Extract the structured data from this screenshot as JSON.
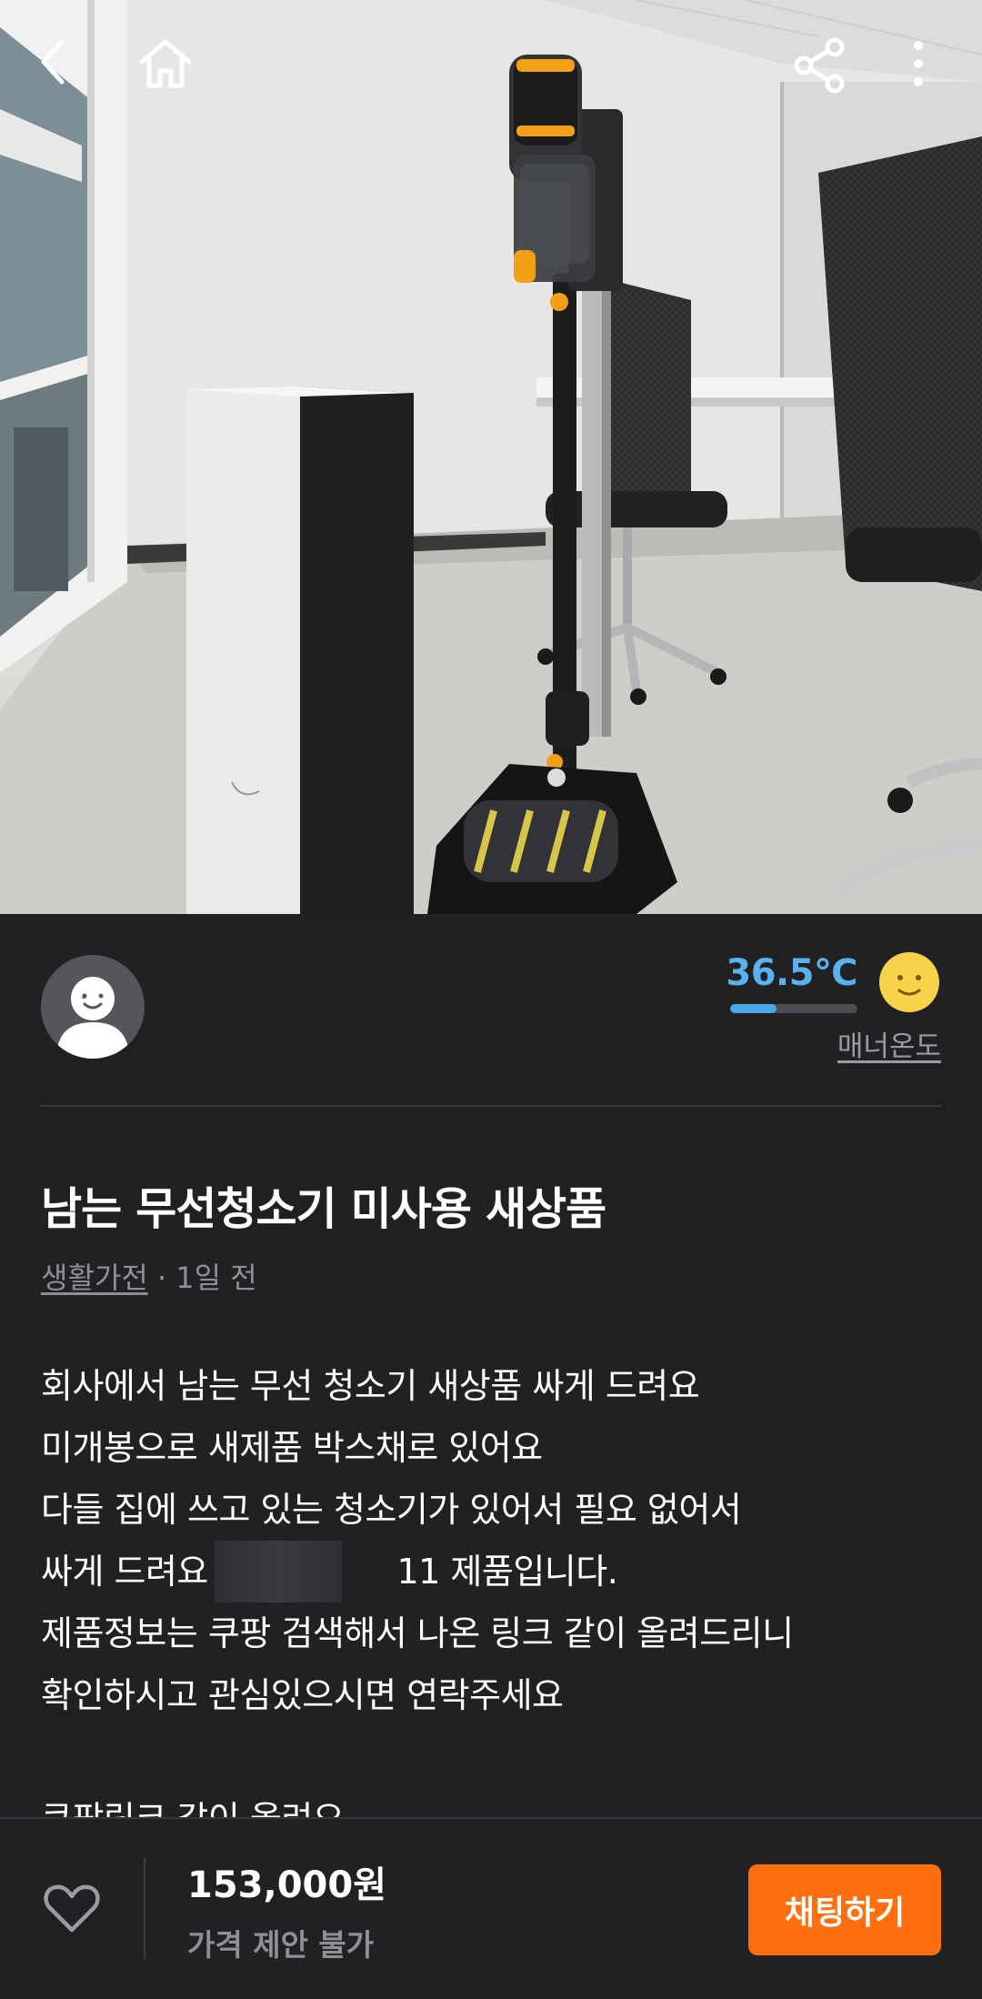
{
  "colors": {
    "background": "#212124",
    "accent": "#ff6f0f",
    "temperature": "#5ab1eb",
    "muted_text": "#8f9095"
  },
  "header": {
    "back_icon": "chevron-left-icon",
    "home_icon": "home-icon",
    "share_icon": "share-icon",
    "more_icon": "more-icon"
  },
  "seller": {
    "nickname": "",
    "temperature": "36.5℃",
    "temperature_level": 0.365,
    "temperature_icon": "smiley-face-icon",
    "manner_label": "매너온도"
  },
  "post": {
    "title": "남는 무선청소기 미사용 새상품",
    "category": "생활가전",
    "time": " · 1일 전",
    "description": {
      "line1": "회사에서 남는 무선 청소기 새상품 싸게 드려요",
      "line2": "미개봉으로 새제품 박스채로 있어요",
      "line3": "다들 집에 쓰고 있는 청소기가 있어서 필요 없어서",
      "line4_start": "싸게 드려요 ",
      "line4_end": "11 제품입니다.",
      "line5": "제품정보는 쿠팡 검색해서 나온 링크 같이 올려드리니",
      "line6": "확인하시고 관심있으시면 연락주세요",
      "line7": "쿠팡링크 같이 올려요"
    }
  },
  "bottom": {
    "price": "153,000원",
    "negotiation": "가격 제안 불가",
    "chat_button": "채팅하기",
    "like_icon": "heart-outline-icon"
  }
}
